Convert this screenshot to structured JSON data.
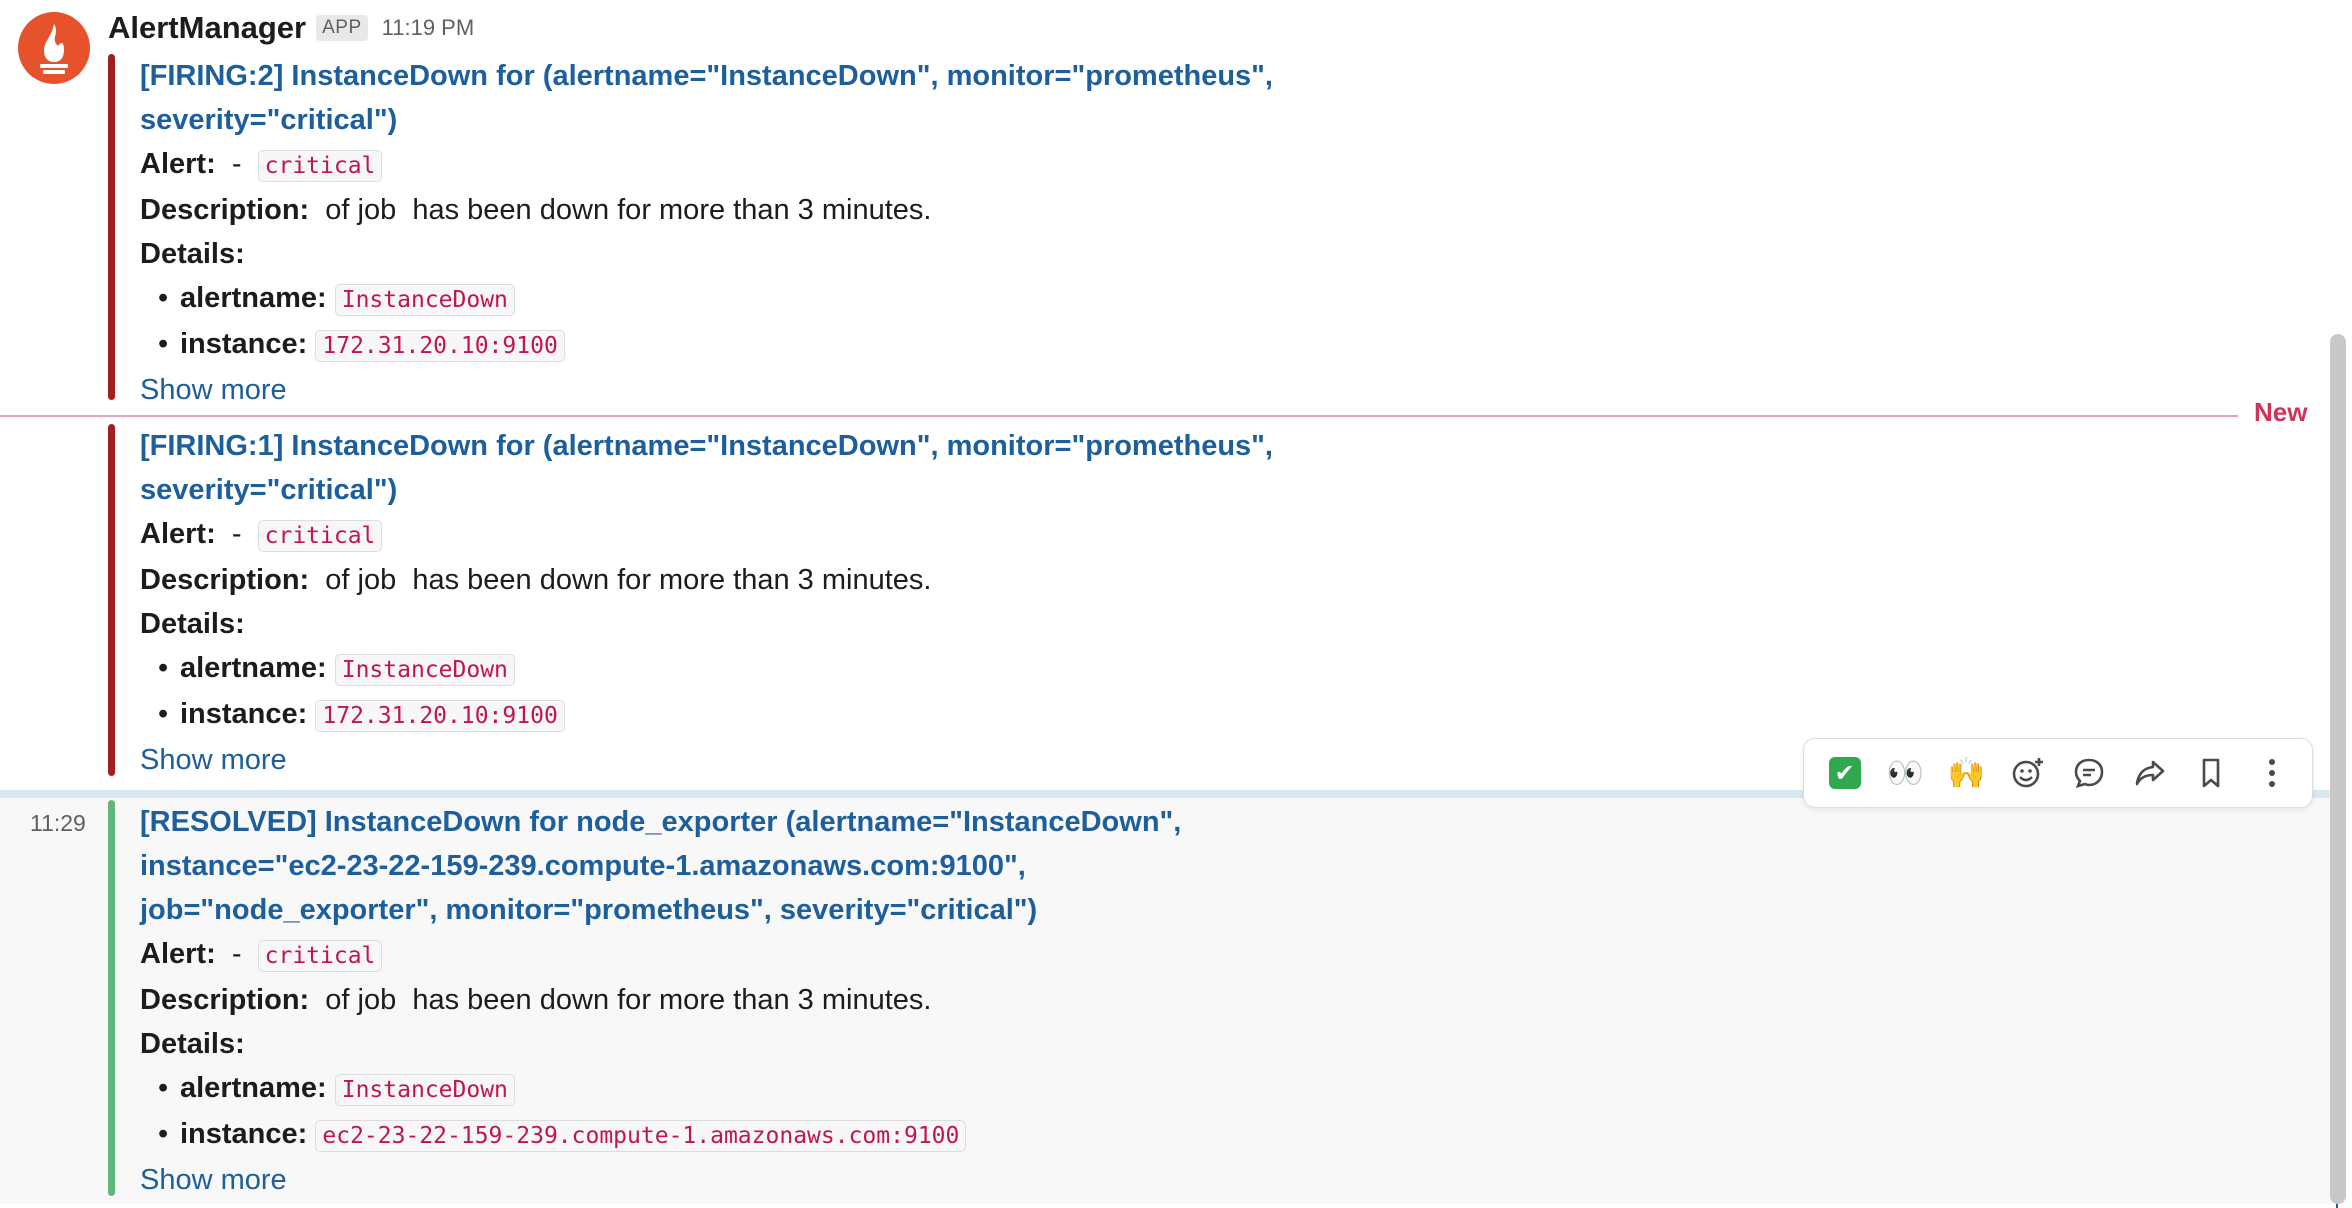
{
  "message": {
    "sender": "AlertManager",
    "app_badge": "APP",
    "time": "11:19 PM"
  },
  "alerts": [
    {
      "status": "firing",
      "title_line1": "[FIRING:2] InstanceDown for  (alertname=\"InstanceDown\", monitor=\"prometheus\",",
      "title_line2": "severity=\"critical\")",
      "alert_label": "Alert:",
      "alert_sep": "  -  ",
      "alert_code": "critical",
      "description_label": "Description:",
      "description_text": "  of job  has been down for more than 3 minutes.",
      "details_label": "Details:",
      "details": [
        {
          "key": "alertname:",
          "value": "InstanceDown"
        },
        {
          "key": "instance:",
          "value": "172.31.20.10:9100"
        }
      ],
      "show_more": "Show more"
    },
    {
      "status": "firing",
      "title_line1": "[FIRING:1] InstanceDown for  (alertname=\"InstanceDown\", monitor=\"prometheus\",",
      "title_line2": "severity=\"critical\")",
      "alert_label": "Alert:",
      "alert_sep": "  -  ",
      "alert_code": "critical",
      "description_label": "Description:",
      "description_text": "  of job  has been down for more than 3 minutes.",
      "details_label": "Details:",
      "details": [
        {
          "key": "alertname:",
          "value": "InstanceDown"
        },
        {
          "key": "instance:",
          "value": "172.31.20.10:9100"
        }
      ],
      "show_more": "Show more"
    },
    {
      "status": "resolved",
      "time": "11:29",
      "title_line1": "[RESOLVED] InstanceDown for node_exporter (alertname=\"InstanceDown\",",
      "title_line2": "instance=\"ec2-23-22-159-239.compute-1.amazonaws.com:9100\",",
      "title_line3": "job=\"node_exporter\", monitor=\"prometheus\", severity=\"critical\")",
      "alert_label": "Alert:",
      "alert_sep": "  -  ",
      "alert_code": "critical",
      "description_label": "Description:",
      "description_text": "  of job  has been down for more than 3 minutes.",
      "details_label": "Details:",
      "details": [
        {
          "key": "alertname:",
          "value": "InstanceDown"
        },
        {
          "key": "instance:",
          "value": "ec2-23-22-159-239.compute-1.amazonaws.com:9100"
        }
      ],
      "show_more": "Show more"
    }
  ],
  "new_divider": "New",
  "toolbar": {
    "icons": [
      "white-check-mark-emoji",
      "eyes-emoji",
      "raised-hands-emoji",
      "add-reaction-icon",
      "reply-in-thread-icon",
      "share-icon",
      "bookmark-icon",
      "more-actions-icon"
    ],
    "check": "✔",
    "eyes": "👀",
    "hands": "🙌"
  },
  "colors": {
    "firing": "#a31f1f",
    "resolved": "#5fb87a",
    "link": "#1d5e9c",
    "new": "#d1325c",
    "avatar": "#e6522c"
  }
}
